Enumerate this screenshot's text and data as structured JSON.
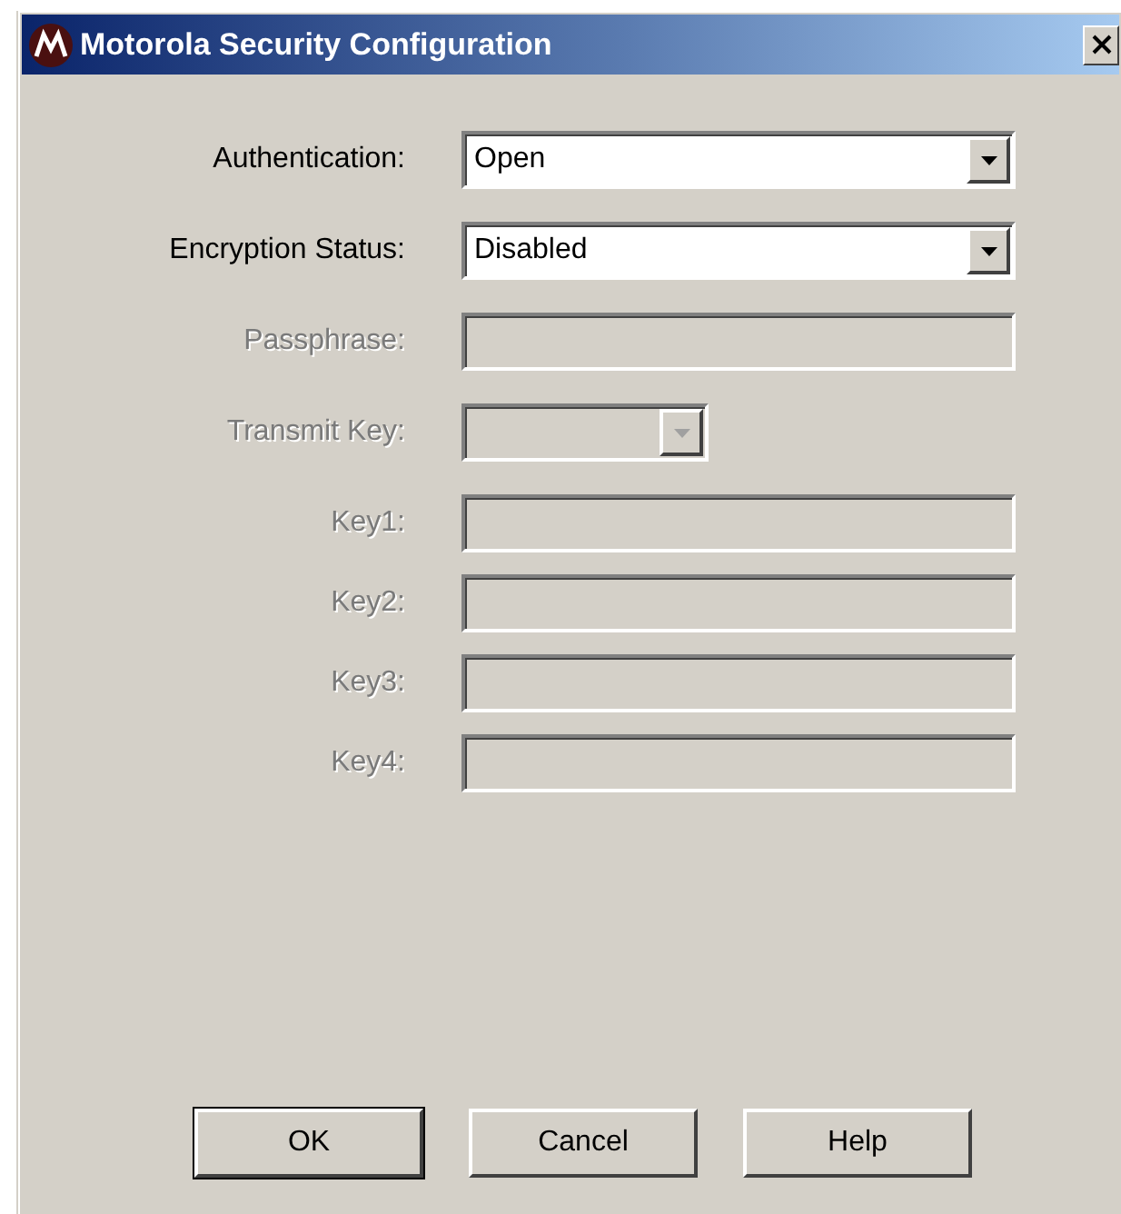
{
  "window": {
    "title": "Motorola Security Configuration"
  },
  "fields": [
    {
      "label": "Authentication:",
      "kind": "dropdown",
      "value": "Open",
      "disabled": false
    },
    {
      "label": "Encryption Status:",
      "kind": "dropdown",
      "value": "Disabled",
      "disabled": false
    },
    {
      "label": "Passphrase:",
      "kind": "text",
      "disabled": true
    },
    {
      "label": "Transmit Key:",
      "kind": "small-dropdown",
      "disabled": true
    }
  ],
  "keys": [
    {
      "label": "Key1:",
      "kind": "text",
      "disabled": true
    },
    {
      "label": "Key2:",
      "kind": "text",
      "disabled": true
    },
    {
      "label": "Key3:",
      "kind": "text",
      "disabled": true
    },
    {
      "label": "Key4:",
      "kind": "text",
      "disabled": true
    }
  ],
  "buttons": [
    {
      "label": "OK",
      "default": true
    },
    {
      "label": "Cancel",
      "default": false
    },
    {
      "label": "Help",
      "default": false
    }
  ]
}
